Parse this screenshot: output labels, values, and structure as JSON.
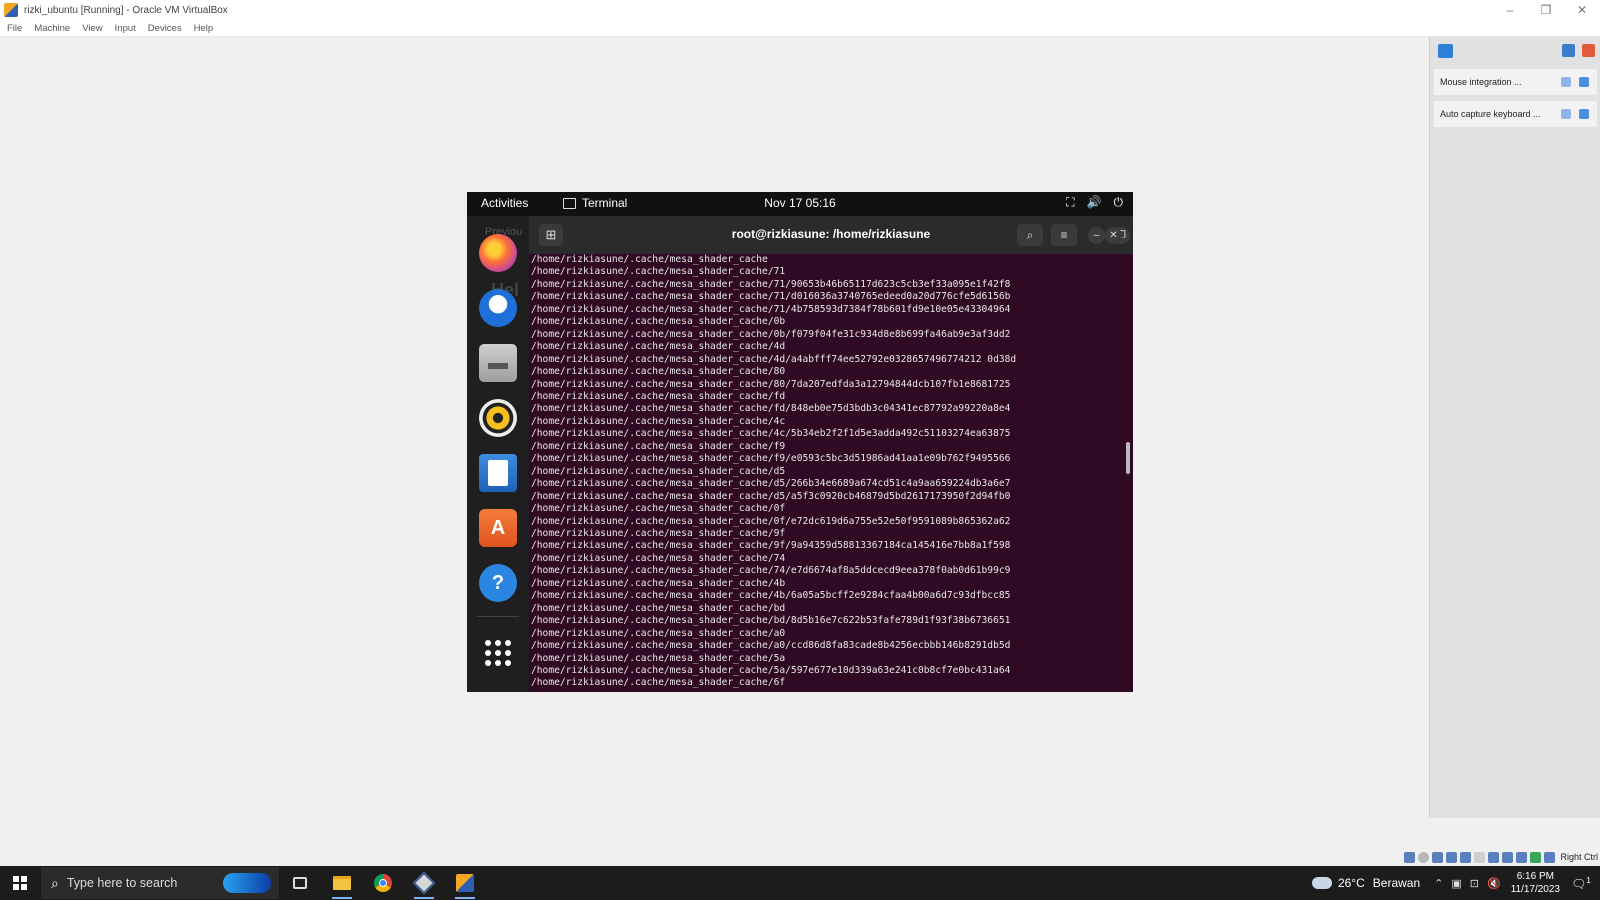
{
  "host": {
    "title": "rizki_ubuntu [Running] - Oracle VM VirtualBox",
    "window_controls": [
      "–",
      "❐",
      "✕"
    ],
    "menu": [
      "File",
      "Machine",
      "View",
      "Input",
      "Devices",
      "Help"
    ]
  },
  "guest": {
    "topbar": {
      "activities": "Activities",
      "app": "Terminal",
      "clock": "Nov 17  05:16",
      "tray": [
        "⛶",
        "🔊",
        "⏻"
      ]
    },
    "dock": {
      "background_text_1": "Previou",
      "background_text_2": "Hel",
      "apps": [
        {
          "name": "firefox",
          "glyph": ""
        },
        {
          "name": "thunderbird",
          "glyph": ""
        },
        {
          "name": "files",
          "glyph": "▬"
        },
        {
          "name": "rhythmbox",
          "glyph": ""
        },
        {
          "name": "libreoffice-writer",
          "glyph": ""
        },
        {
          "name": "ubuntu-software",
          "glyph": "A"
        },
        {
          "name": "help",
          "glyph": "?"
        }
      ]
    },
    "terminal": {
      "title": "root@rizkiasune: /home/rizkiasune",
      "new_tab": "⊞",
      "search": "⌕",
      "menu": "≡",
      "minimize": "–",
      "restore": "❐",
      "close": "✕",
      "lines": [
        "/home/rizkiasune/.cache/mesa_shader_cache",
        "/home/rizkiasune/.cache/mesa_shader_cache/71",
        "/home/rizkiasune/.cache/mesa_shader_cache/71/90653b46b65117d623c5cb3ef33a095e1f42f8",
        "/home/rizkiasune/.cache/mesa_shader_cache/71/d016036a3740765edeed0a20d776cfe5d6156b",
        "/home/rizkiasune/.cache/mesa_shader_cache/71/4b758593d7384f78b601fd9e10e05e43304964",
        "/home/rizkiasune/.cache/mesa_shader_cache/0b",
        "/home/rizkiasune/.cache/mesa_shader_cache/0b/f079f04fe31c934d8e8b699fa46ab9e3af3dd2",
        "/home/rizkiasune/.cache/mesa_shader_cache/4d",
        "/home/rizkiasune/.cache/mesa_shader_cache/4d/a4abfff74ee52792e0328657496774212 0d38d",
        "/home/rizkiasune/.cache/mesa_shader_cache/80",
        "/home/rizkiasune/.cache/mesa_shader_cache/80/7da207edfda3a12794844dcb107fb1e8681725",
        "/home/rizkiasune/.cache/mesa_shader_cache/fd",
        "/home/rizkiasune/.cache/mesa_shader_cache/fd/848eb0e75d3bdb3c04341ec87792a99220a8e4",
        "/home/rizkiasune/.cache/mesa_shader_cache/4c",
        "/home/rizkiasune/.cache/mesa_shader_cache/4c/5b34eb2f2f1d5e3adda492c51103274ea63875",
        "/home/rizkiasune/.cache/mesa_shader_cache/f9",
        "/home/rizkiasune/.cache/mesa_shader_cache/f9/e0593c5bc3d51986ad41aa1e09b762f9495566",
        "/home/rizkiasune/.cache/mesa_shader_cache/d5",
        "/home/rizkiasune/.cache/mesa_shader_cache/d5/266b34e6689a674cd51c4a9aa659224db3a6e7",
        "/home/rizkiasune/.cache/mesa_shader_cache/d5/a5f3c0920cb46879d5bd2617173950f2d94fb0",
        "/home/rizkiasune/.cache/mesa_shader_cache/0f",
        "/home/rizkiasune/.cache/mesa_shader_cache/0f/e72dc619d6a755e52e50f9591089b865362a62",
        "/home/rizkiasune/.cache/mesa_shader_cache/9f",
        "/home/rizkiasune/.cache/mesa_shader_cache/9f/9a94359d58813367184ca145416e7bb8a1f598",
        "/home/rizkiasune/.cache/mesa_shader_cache/74",
        "/home/rizkiasune/.cache/mesa_shader_cache/74/e7d6674af8a5ddcecd9eea378f0ab0d61b99c9",
        "/home/rizkiasune/.cache/mesa_shader_cache/4b",
        "/home/rizkiasune/.cache/mesa_shader_cache/4b/6a05a5bcff2e9284cfaa4b00a6d7c93dfbcc85",
        "/home/rizkiasune/.cache/mesa_shader_cache/bd",
        "/home/rizkiasune/.cache/mesa_shader_cache/bd/8d5b16e7c622b53fafe789d1f93f38b6736651",
        "/home/rizkiasune/.cache/mesa_shader_cache/a0",
        "/home/rizkiasune/.cache/mesa_shader_cache/a0/ccd86d8fa83cade8b4256ecbbb146b8291db5d",
        "/home/rizkiasune/.cache/mesa_shader_cache/5a",
        "/home/rizkiasune/.cache/mesa_shader_cache/5a/597e677e10d339a63e241c0b8cf7e0bc431a64",
        "/home/rizkiasune/.cache/mesa_shader_cache/6f"
      ]
    }
  },
  "vbox_panel": {
    "notifications": [
      {
        "text": "Mouse integration ..."
      },
      {
        "text": "Auto capture keyboard ..."
      }
    ],
    "host_key": "Right Ctrl"
  },
  "taskbar": {
    "search_placeholder": "Type here to search",
    "search_icon": "⌕",
    "weather_temp": "26°C",
    "weather_condition": "Berawan",
    "tray_chevron": "⌃",
    "tray_icons": [
      "▣",
      "⊡",
      "🔇"
    ],
    "time": "6:16 PM",
    "date": "11/17/2023",
    "notification_icon": "🗨",
    "notification_count": "1"
  }
}
